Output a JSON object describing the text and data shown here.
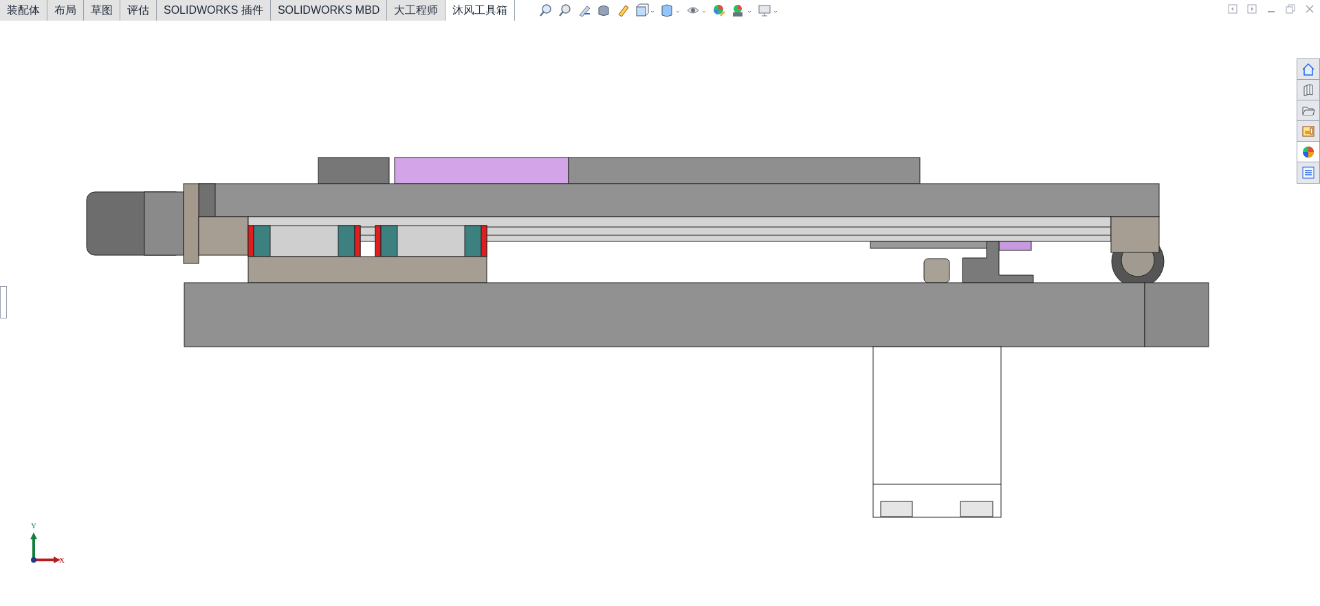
{
  "tabs": [
    {
      "label": "装配体",
      "selected": false
    },
    {
      "label": "布局",
      "selected": false
    },
    {
      "label": "草图",
      "selected": false
    },
    {
      "label": "评估",
      "selected": false
    },
    {
      "label": "SOLIDWORKS 插件",
      "selected": false
    },
    {
      "label": "SOLIDWORKS MBD",
      "selected": false
    },
    {
      "label": "大工程师",
      "selected": false
    },
    {
      "label": "沐风工具箱",
      "selected": true
    }
  ],
  "triad": {
    "y_label": "Y",
    "x_label": "X"
  }
}
